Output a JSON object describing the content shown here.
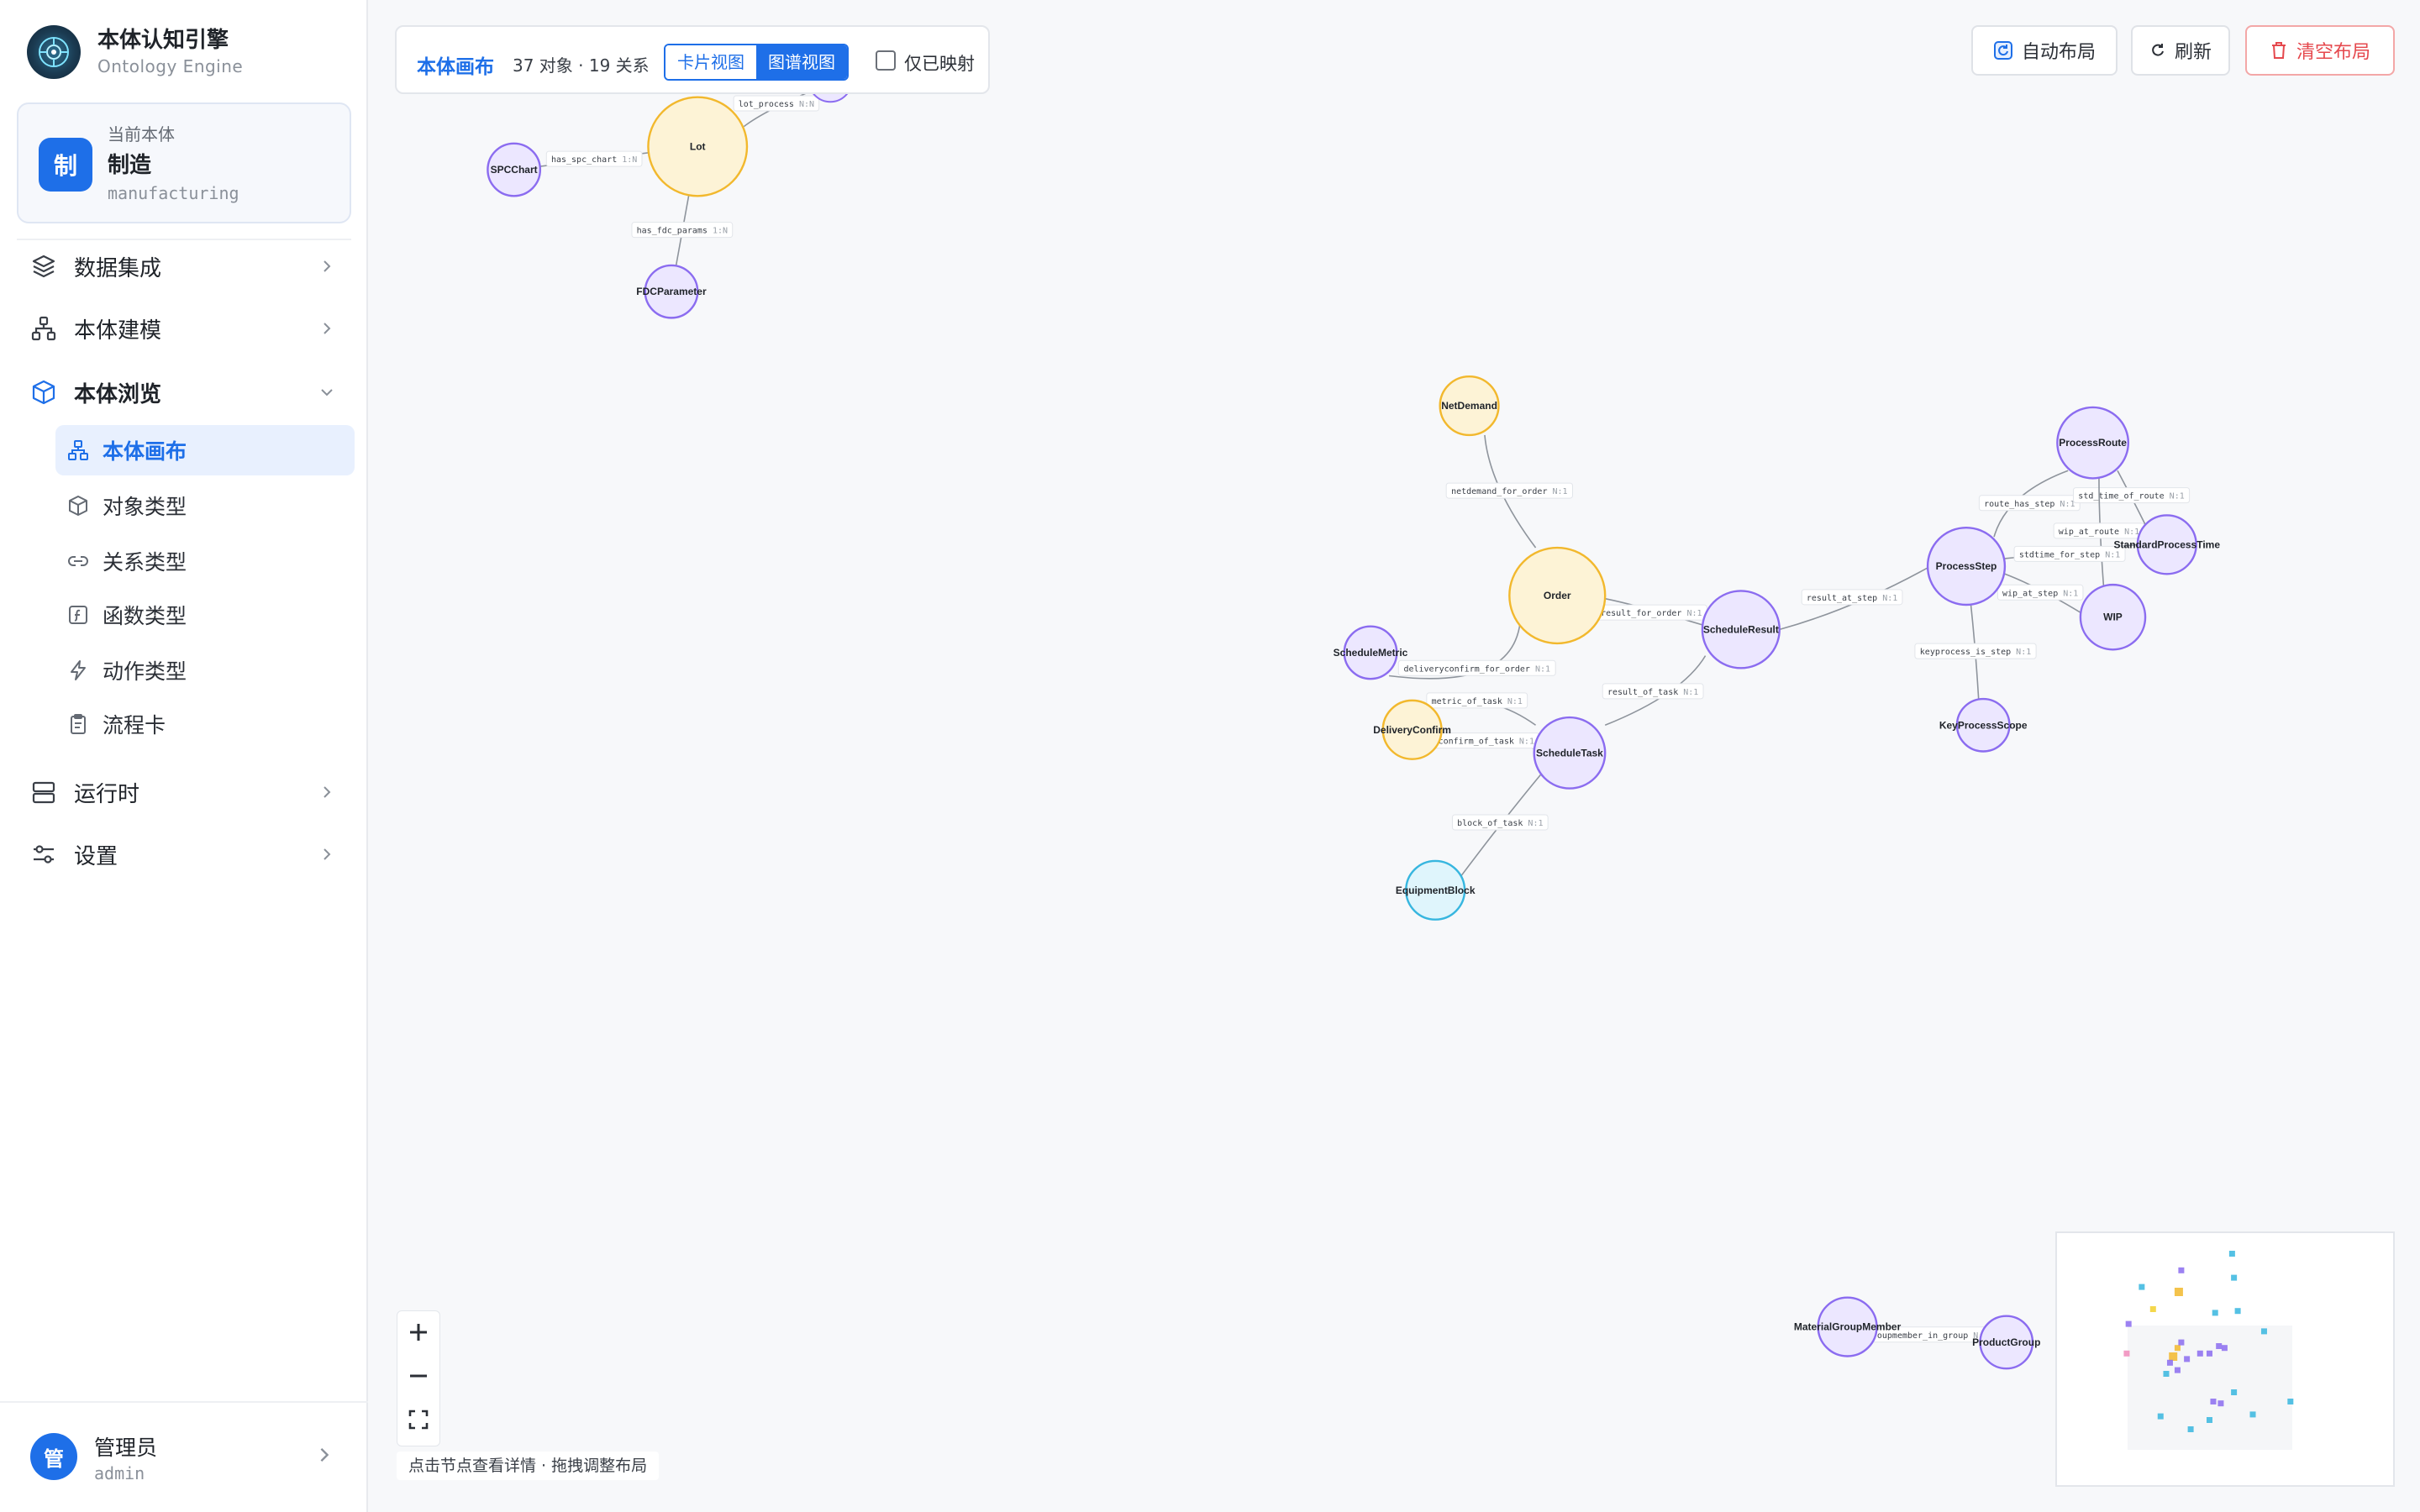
{
  "brand": {
    "title": "本体认知引擎",
    "subtitle": "Ontology Engine"
  },
  "ontology": {
    "label": "当前本体",
    "name": "制造",
    "code": "manufacturing",
    "avatar": "制"
  },
  "nav": {
    "data_integration": "数据集成",
    "modeling": "本体建模",
    "browse": "本体浏览",
    "browse_items": [
      {
        "label": "本体画布",
        "icon": "canvas-icon",
        "active": true
      },
      {
        "label": "对象类型",
        "icon": "cube-icon",
        "active": false
      },
      {
        "label": "关系类型",
        "icon": "link-icon",
        "active": false
      },
      {
        "label": "函数类型",
        "icon": "function-icon",
        "active": false
      },
      {
        "label": "动作类型",
        "icon": "bolt-icon",
        "active": false
      },
      {
        "label": "流程卡",
        "icon": "clipboard-icon",
        "active": false
      }
    ],
    "runtime": "运行时",
    "settings": "设置"
  },
  "user": {
    "name": "管理员",
    "id": "admin",
    "avatar": "管"
  },
  "toolbar": {
    "title": "本体画布",
    "stats": "37 对象 · 19 关系",
    "card_view": "卡片视图",
    "graph_view": "图谱视图",
    "only_mapped": "仅已映射",
    "only_mapped_checked": false
  },
  "actions": {
    "auto_layout": "自动布局",
    "refresh": "刷新",
    "clear_layout": "清空布局"
  },
  "hint": "点击节点查看详情 · 拖拽调整布局",
  "colors": {
    "primary": "#1e6fe8",
    "danger": "#e5484d",
    "node_purple": "#8b6cf0",
    "node_yellow": "#f2b82d",
    "node_cyan": "#37b6df"
  },
  "graph": {
    "nodes": [
      {
        "id": "Lot",
        "label": "Lot",
        "kind": "yellow"
      },
      {
        "id": "SPCChart",
        "label": "SPCChart",
        "kind": "purple"
      },
      {
        "id": "FDCParameter",
        "label": "FDCParameter",
        "kind": "purple"
      },
      {
        "id": "NetDemand",
        "label": "NetDemand",
        "kind": "yellow"
      },
      {
        "id": "Order",
        "label": "Order",
        "kind": "yellow"
      },
      {
        "id": "ScheduleResult",
        "label": "ScheduleResult",
        "kind": "purple"
      },
      {
        "id": "ScheduleMetric",
        "label": "ScheduleMetric",
        "kind": "purple"
      },
      {
        "id": "DeliveryConfirm",
        "label": "DeliveryConfirm",
        "kind": "yellow"
      },
      {
        "id": "ScheduleTask",
        "label": "ScheduleTask",
        "kind": "purple"
      },
      {
        "id": "EquipmentBlock",
        "label": "EquipmentBlock",
        "kind": "cyan"
      },
      {
        "id": "ProcessStep",
        "label": "ProcessStep",
        "kind": "purple"
      },
      {
        "id": "ProcessRoute",
        "label": "ProcessRoute",
        "kind": "purple"
      },
      {
        "id": "StandardProcessTime",
        "label": "StandardProcessTime",
        "kind": "purple"
      },
      {
        "id": "WIP",
        "label": "WIP",
        "kind": "purple"
      },
      {
        "id": "KeyProcessScope",
        "label": "KeyProcessScope",
        "kind": "purple"
      },
      {
        "id": "MaterialGroupMember",
        "label": "MaterialGroupMember",
        "kind": "purple"
      },
      {
        "id": "ProductGroup",
        "label": "ProductGroup",
        "kind": "purple"
      }
    ],
    "edges": [
      {
        "label": "lot_process",
        "card": "N:N"
      },
      {
        "label": "has_spc_chart",
        "card": "1:N"
      },
      {
        "label": "has_fdc_params",
        "card": "1:N"
      },
      {
        "label": "netdemand_for_order",
        "card": "N:1"
      },
      {
        "label": "result_for_order",
        "card": "N:1"
      },
      {
        "label": "deliveryconfirm_for_order",
        "card": "N:1"
      },
      {
        "label": "metric_of_task",
        "card": "N:1"
      },
      {
        "label": "confirm_of_task",
        "card": "N:1"
      },
      {
        "label": "result_of_task",
        "card": "N:1"
      },
      {
        "label": "block_of_task",
        "card": "N:1"
      },
      {
        "label": "result_at_step",
        "card": "N:1"
      },
      {
        "label": "route_has_step",
        "card": "N:1"
      },
      {
        "label": "std_time_of_route",
        "card": "N:1"
      },
      {
        "label": "wip_at_route",
        "card": "N:1"
      },
      {
        "label": "stdtime_for_step",
        "card": "N:1"
      },
      {
        "label": "wip_at_step",
        "card": "N:1"
      },
      {
        "label": "keyprocess_is_step",
        "card": "N:1"
      },
      {
        "label": "groupmember_in_group",
        "card": "N:1"
      }
    ]
  }
}
